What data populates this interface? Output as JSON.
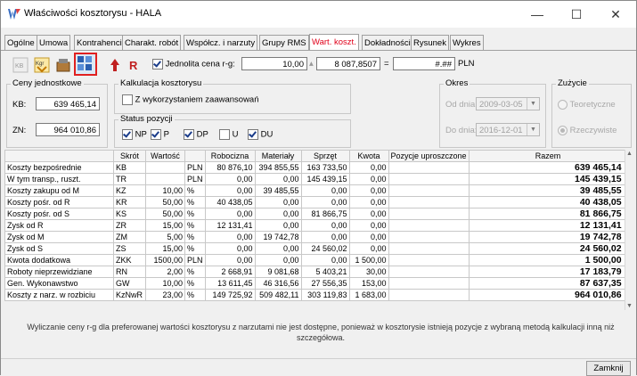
{
  "window": {
    "title": "Właściwości kosztorysu - HALA",
    "minimize": "—",
    "maximize": "☐",
    "close": "✕"
  },
  "tabs": [
    "Ogólne",
    "Umowa",
    "Kontrahenci",
    "Charakt. robót",
    "Współcz. i narzuty",
    "Grupy RMS",
    "Wart. koszt.",
    "Dokładności",
    "Rysunek",
    "Wykres"
  ],
  "active_tab": "Wart. koszt.",
  "toolbar": {
    "jednolita_label": "Jednolita cena r-g:",
    "jednolita_checked": true,
    "rate_value": "10,00",
    "total_value": "8 087,8507",
    "equals": "=",
    "result_value": "#.##",
    "currency": "PLN",
    "icons": [
      "kb-icon",
      "kgr-icon",
      "tools-icon",
      "calculator-icon",
      "arrow-icon",
      "r-icon"
    ]
  },
  "ceny": {
    "label": "Ceny jednostkowe",
    "kb_label": "KB:",
    "kb_value": "639 465,14",
    "zn_label": "ZN:",
    "zn_value": "964 010,86"
  },
  "kalkulacja": {
    "label": "Kalkulacja kosztorysu",
    "option_label": "Z wykorzystaniem zaawansowań",
    "option_checked": false
  },
  "status": {
    "label": "Status pozycji",
    "items": [
      {
        "label": "NP",
        "checked": true
      },
      {
        "label": "P",
        "checked": true
      },
      {
        "label": "DP",
        "checked": true
      },
      {
        "label": "U",
        "checked": false
      },
      {
        "label": "DU",
        "checked": true
      }
    ]
  },
  "okres": {
    "label": "Okres",
    "od_label": "Od dnia:",
    "od_value": "2009-03-05",
    "do_label": "Do dnia:",
    "do_value": "2016-12-01"
  },
  "zuzycie": {
    "label": "Zużycie",
    "opt1": "Teoretyczne",
    "opt2": "Rzeczywiste",
    "selected": "Rzeczywiste"
  },
  "table": {
    "headers": [
      "",
      "Skrót",
      "Wartość",
      "",
      "Robocizna",
      "Materiały",
      "Sprzęt",
      "Kwota",
      "Pozycje uproszczone",
      "Razem"
    ],
    "rows": [
      [
        "Koszty bezpośrednie",
        "KB",
        "",
        "PLN",
        "80 876,10",
        "394 855,55",
        "163 733,50",
        "0,00",
        "",
        "639 465,14"
      ],
      [
        "W tym transp., ruszt.",
        "TR",
        "",
        "PLN",
        "0,00",
        "0,00",
        "145 439,15",
        "0,00",
        "",
        "145 439,15"
      ],
      [
        "Koszty zakupu od M",
        "KZ",
        "10,00",
        "%",
        "0,00",
        "39 485,55",
        "0,00",
        "0,00",
        "",
        "39 485,55"
      ],
      [
        "Koszty pośr. od R",
        "KR",
        "50,00",
        "%",
        "40 438,05",
        "0,00",
        "0,00",
        "0,00",
        "",
        "40 438,05"
      ],
      [
        "Koszty pośr. od S",
        "KS",
        "50,00",
        "%",
        "0,00",
        "0,00",
        "81 866,75",
        "0,00",
        "",
        "81 866,75"
      ],
      [
        "Zysk od R",
        "ZR",
        "15,00",
        "%",
        "12 131,41",
        "0,00",
        "0,00",
        "0,00",
        "",
        "12 131,41"
      ],
      [
        "Zysk od M",
        "ZM",
        "5,00",
        "%",
        "0,00",
        "19 742,78",
        "0,00",
        "0,00",
        "",
        "19 742,78"
      ],
      [
        "Zysk od S",
        "ZS",
        "15,00",
        "%",
        "0,00",
        "0,00",
        "24 560,02",
        "0,00",
        "",
        "24 560,02"
      ],
      [
        "Kwota dodatkowa",
        "ZKK",
        "1500,00",
        "PLN",
        "0,00",
        "0,00",
        "0,00",
        "1 500,00",
        "",
        "1 500,00"
      ],
      [
        "Roboty nieprzewidziane",
        "RN",
        "2,00",
        "%",
        "2 668,91",
        "9 081,68",
        "5 403,21",
        "30,00",
        "",
        "17 183,79"
      ],
      [
        "Gen. Wykonawstwo",
        "GW",
        "10,00",
        "%",
        "13 611,45",
        "46 316,56",
        "27 556,35",
        "153,00",
        "",
        "87 637,35"
      ],
      [
        "Koszty z narz. w rozbiciu",
        "KzNwR",
        "23,00",
        "%",
        "149 725,92",
        "509 482,11",
        "303 119,83",
        "1 683,00",
        "",
        "964 010,86"
      ]
    ]
  },
  "message": "Wyliczanie ceny r-g dla preferowanej wartości kosztorysu z narzutami nie jest dostępne, ponieważ w kosztorysie  istnieją pozycje z wybraną metodą kalkulacji inną niż szczegółowa.",
  "close_button": "Zamknij"
}
